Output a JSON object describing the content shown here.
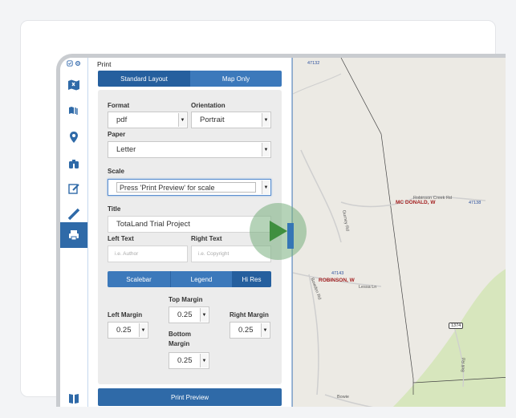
{
  "panel": {
    "title": "Print",
    "layout_tabs": [
      {
        "label": "Standard Layout",
        "active": true
      },
      {
        "label": "Map Only",
        "active": false
      }
    ],
    "format": {
      "label": "Format",
      "value": "pdf"
    },
    "orientation": {
      "label": "Orientation",
      "value": "Portrait"
    },
    "paper": {
      "label": "Paper",
      "value": "Letter"
    },
    "scale": {
      "label": "Scale",
      "value": "Press 'Print Preview' for scale"
    },
    "title_field": {
      "label": "Title",
      "value": "TotaLand Trial Project"
    },
    "left_text": {
      "label": "Left Text",
      "placeholder": "i.e. Author"
    },
    "right_text": {
      "label": "Right Text",
      "placeholder": "i.e. Copyright"
    },
    "options_tabs": [
      "Scalebar",
      "Legend",
      "Hi Res"
    ],
    "top_margin": {
      "label": "Top Margin",
      "value": "0.25"
    },
    "left_margin": {
      "label": "Left Margin",
      "value": "0.25"
    },
    "right_margin": {
      "label": "Right Margin",
      "value": "0.25"
    },
    "bottom_margin": {
      "label": "Bottom Margin",
      "value": "0.25"
    },
    "preview_button": "Print Preview"
  },
  "rail_icons": [
    "layers-icon",
    "settings-icon",
    "map-icon",
    "tools-icon",
    "location-pin-icon",
    "binoculars-icon",
    "edit-icon",
    "measure-icon",
    "print-icon",
    "book-icon"
  ],
  "map": {
    "labels": {
      "code_top": "47132",
      "owner_1": "MC DONALD, W",
      "code_right": "47138",
      "road_1": "Robinson Creek Rd",
      "owner_2": "ROBINSON, W",
      "code_mid": "47143",
      "road_2": "Lessa Ln",
      "road_3": "Gurney Rd",
      "road_4": "Bowden Rd",
      "shield": "1374",
      "road_5": "Bell Rd",
      "road_6": "Bowie"
    }
  },
  "colors": {
    "accent": "#2f6aa8",
    "map_green": "#d7e6bd",
    "play_overlay": "#7aaf7d"
  }
}
